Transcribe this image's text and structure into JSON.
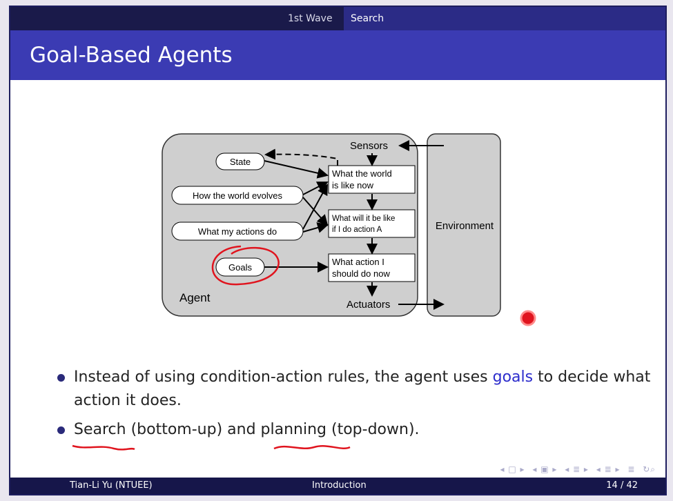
{
  "nav": {
    "tabs": [
      {
        "label": "1st Wave"
      },
      {
        "label": "Search"
      }
    ]
  },
  "slide": {
    "title": "Goal-Based Agents"
  },
  "diagram": {
    "agent_label": "Agent",
    "environment_label": "Environment",
    "sensors_label": "Sensors",
    "actuators_label": "Actuators",
    "state": "State",
    "world_evolves": "How the world evolves",
    "my_actions": "What my actions do",
    "goals": "Goals",
    "box1": [
      "What the world",
      "is like now"
    ],
    "box2": [
      "What will it be like",
      "if I do action A"
    ],
    "box3": [
      "What action I",
      "should do now"
    ]
  },
  "bullets": {
    "b1_pre": "Instead of using condition-action rules, the agent uses ",
    "b1_hl": "goals",
    "b1_post": " to decide what action it does.",
    "b2_search": "Search",
    "b2_mid": " (bottom-up) and ",
    "b2_planning": "planning",
    "b2_post": " (top-down)."
  },
  "footer": {
    "author": "Tian-Li Yu  (NTUEE)",
    "section": "Introduction",
    "page": "14 / 42"
  },
  "colors": {
    "header_dark": "#1a1a4a",
    "title_blue": "#3b3bb3",
    "goal_link": "#2c2ccc",
    "annotation_red": "#e0141e"
  }
}
